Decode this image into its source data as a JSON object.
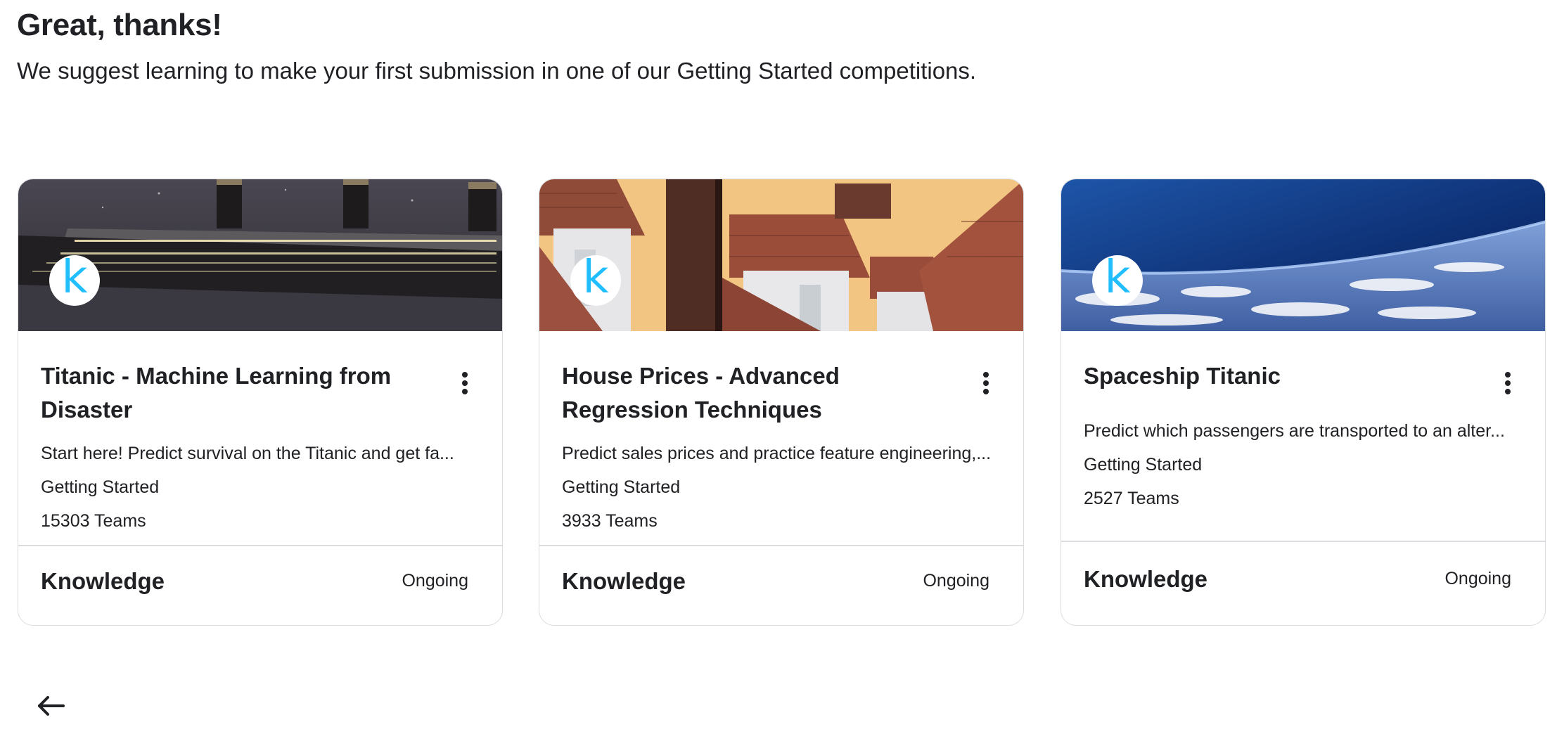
{
  "header": {
    "title": "Great, thanks!",
    "subtitle": "We suggest learning to make your first submission in one of our Getting Started competitions."
  },
  "cards": [
    {
      "title": "Titanic - Machine Learning from Disaster",
      "description": "Start here! Predict survival on the Titanic and get fa...",
      "category": "Getting Started",
      "teams": "15303 Teams",
      "footer_category": "Knowledge",
      "status": "Ongoing",
      "logo_letter": "k"
    },
    {
      "title": "House Prices - Advanced Regression Techniques",
      "description": "Predict sales prices and practice feature engineering,...",
      "category": "Getting Started",
      "teams": "3933 Teams",
      "footer_category": "Knowledge",
      "status": "Ongoing",
      "logo_letter": "k"
    },
    {
      "title": "Spaceship Titanic",
      "description": "Predict which passengers are transported to an alter...",
      "category": "Getting Started",
      "teams": "2527 Teams",
      "footer_category": "Knowledge",
      "status": "Ongoing",
      "logo_letter": "k"
    }
  ],
  "icons": {
    "menu": "more-vertical-icon",
    "back": "arrow-left-icon",
    "logo": "kaggle-k-logo"
  },
  "colors": {
    "logo_accent": "#20beff",
    "text": "#202124",
    "border": "#dadce0"
  }
}
